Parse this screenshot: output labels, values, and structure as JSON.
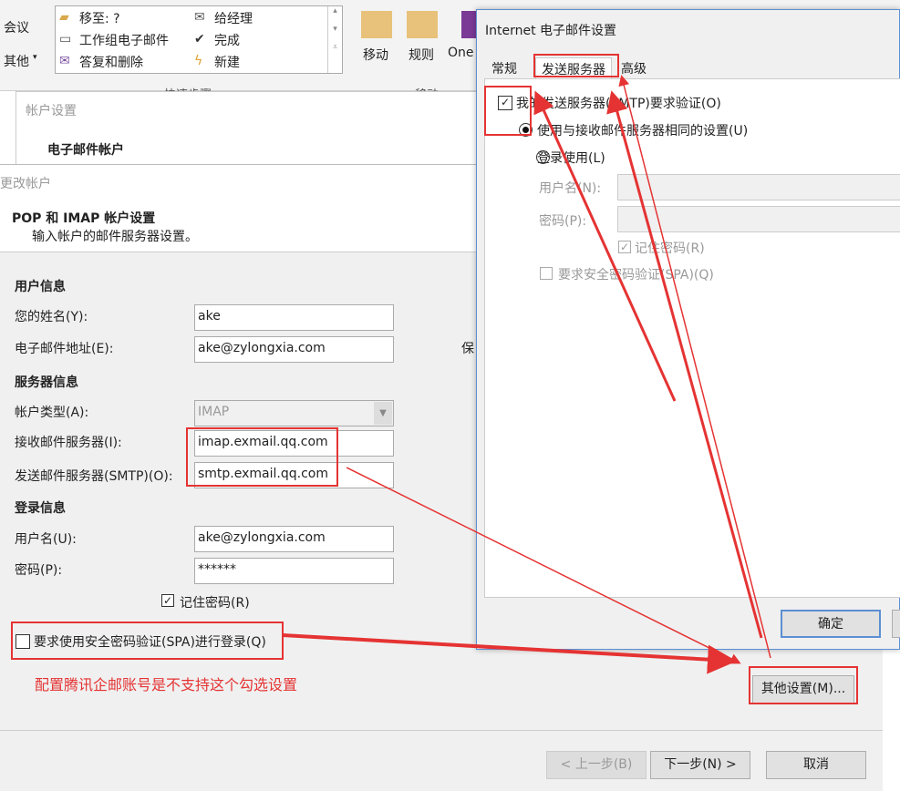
{
  "ribbon": {
    "meeting": "会议",
    "other": "其他",
    "quick_steps": [
      "移至: ?",
      "工作组电子邮件",
      "答复和删除",
      "给经理",
      "完成",
      "新建"
    ],
    "group_quick": "快速步骤",
    "move": "移动",
    "rules": "规则",
    "onenote": "One",
    "group_move": "移动"
  },
  "account_settings": {
    "title": "帐户设置",
    "heading": "电子邮件帐户"
  },
  "change_account": {
    "title": "更改帐户",
    "heading": "POP 和 IMAP 帐户设置",
    "subheading": "输入帐户的邮件服务器设置。",
    "user_info": "用户信息",
    "name_label": "您的姓名(Y):",
    "name_value": "ake",
    "email_label": "电子邮件地址(E):",
    "email_value": "ake@zylongxia.com",
    "server_info": "服务器信息",
    "account_type_label": "帐户类型(A):",
    "account_type_value": "IMAP",
    "incoming_label": "接收邮件服务器(I):",
    "incoming_value": "imap.exmail.qq.com",
    "outgoing_label": "发送邮件服务器(SMTP)(O):",
    "outgoing_value": "smtp.exmail.qq.com",
    "login_info": "登录信息",
    "username_label": "用户名(U):",
    "username_value": "ake@zylongxia.com",
    "password_label": "密码(P):",
    "password_value": "******",
    "remember": "记住密码(R)",
    "spa": "要求使用安全密码验证(SPA)进行登录(Q)",
    "annotation": "配置腾讯企邮账号是不支持这个勾选设置",
    "partial": "保",
    "more_settings": "其他设置(M)...",
    "back": "< 上一步(B)",
    "next": "下一步(N) >",
    "cancel": "取消"
  },
  "internet_settings": {
    "title": "Internet 电子邮件设置",
    "tabs": [
      "常规",
      "发送服务器",
      "高级"
    ],
    "smtp_auth": "我的发送服务器(SMTP)要求验证(O)",
    "smtp_auth_checked": true,
    "same_settings": "使用与接收邮件服务器相同的设置(U)",
    "login_with": "登录使用(L)",
    "username_label": "用户名(N):",
    "password_label": "密码(P):",
    "remember": "记住密码(R)",
    "spa": "要求安全密码验证(SPA)(Q)",
    "ok": "确定"
  },
  "colors": {
    "annotation": "#e53333",
    "accent": "#5b8fd3"
  }
}
